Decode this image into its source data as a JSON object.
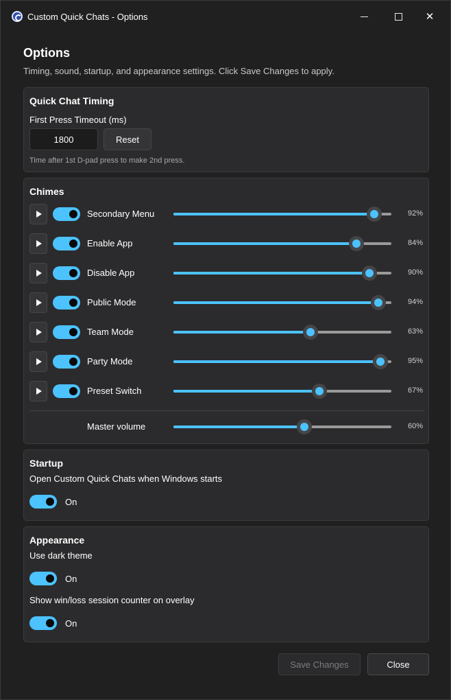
{
  "window": {
    "title": "Custom Quick Chats - Options",
    "close_glyph": "✕"
  },
  "header": {
    "title": "Options",
    "subtitle": "Timing, sound, startup, and appearance settings. Click Save Changes to apply."
  },
  "timing": {
    "title": "Quick Chat Timing",
    "label": "First Press Timeout (ms)",
    "value": "1800",
    "reset_label": "Reset",
    "hint": "Time after 1st D-pad press to make 2nd press."
  },
  "chimes": {
    "title": "Chimes",
    "items": [
      {
        "label": "Secondary Menu",
        "enabled": true,
        "volume": 92,
        "pct": "92%"
      },
      {
        "label": "Enable App",
        "enabled": true,
        "volume": 84,
        "pct": "84%"
      },
      {
        "label": "Disable App",
        "enabled": true,
        "volume": 90,
        "pct": "90%"
      },
      {
        "label": "Public Mode",
        "enabled": true,
        "volume": 94,
        "pct": "94%"
      },
      {
        "label": "Team Mode",
        "enabled": true,
        "volume": 63,
        "pct": "63%"
      },
      {
        "label": "Party Mode",
        "enabled": true,
        "volume": 95,
        "pct": "95%"
      },
      {
        "label": "Preset Switch",
        "enabled": true,
        "volume": 67,
        "pct": "67%"
      }
    ],
    "master": {
      "label": "Master volume",
      "volume": 60,
      "pct": "60%"
    }
  },
  "startup": {
    "title": "Startup",
    "label": "Open Custom Quick Chats when Windows starts",
    "toggle_text": "On"
  },
  "appearance": {
    "title": "Appearance",
    "dark_label": "Use dark theme",
    "dark_toggle_text": "On",
    "counter_label": "Show win/loss session counter on overlay",
    "counter_toggle_text": "On"
  },
  "footer": {
    "save_label": "Save Changes",
    "close_label": "Close"
  },
  "colors": {
    "accent": "#4cc2ff",
    "background": "#202021",
    "card": "#2b2b2d"
  }
}
